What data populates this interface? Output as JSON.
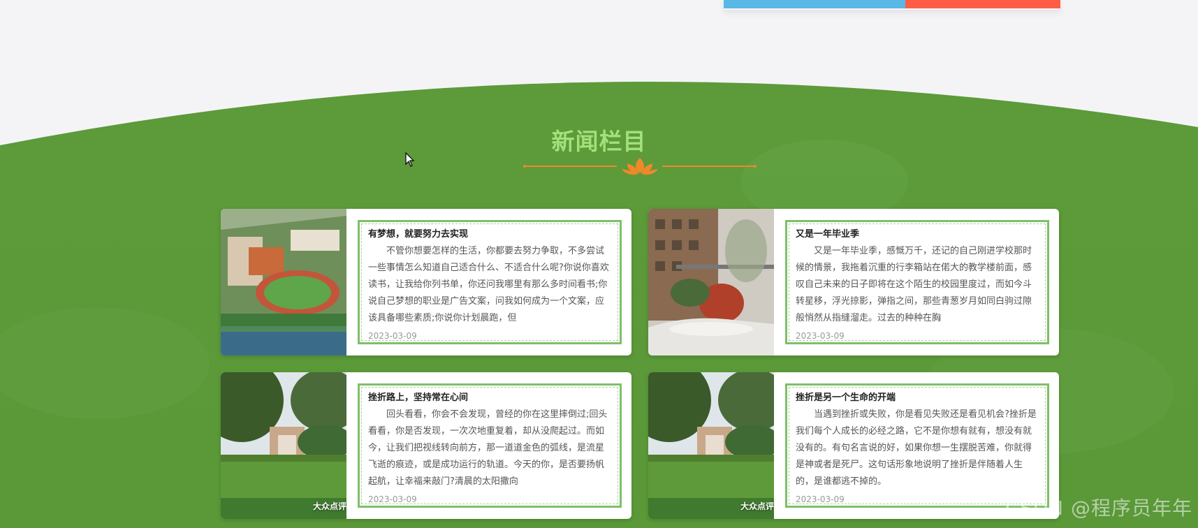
{
  "section": {
    "title": "新闻栏目"
  },
  "news": [
    {
      "title": "有梦想，就要努力去实现",
      "excerpt": "不管你想要怎样的生活，你都要去努力争取，不多尝试一些事情怎么知道自己适合什么、不适合什么呢?你说你喜欢读书，让我给你列书单，你还问我哪里有那么多时间看书;你说自己梦想的职业是广告文案，问我如何成为一个文案，应该具备哪些素质;你说你计划晨跑，但",
      "date": "2023-03-09",
      "image": "campus-aerial"
    },
    {
      "title": "又是一年毕业季",
      "excerpt": "又是一年毕业季，感慨万千，还记的自己刚进学校那时候的情景，我拖着沉重的行李箱站在偌大的教学楼前面，感叹自己未来的日子即将在这个陌生的校园里度过，而如今斗转星移，浮光掠影，弹指之间，那些青葱岁月如同白驹过隙般悄然从指缝溜走。过去的种种在胸",
      "date": "2023-03-09",
      "image": "courtyard"
    },
    {
      "title": "挫折路上，坚持常在心间",
      "excerpt": "回头看看，你会不会发现，曾经的你在这里摔倒过;回头看看，你是否发现，一次次地重复着，却从没爬起过。而如今，让我们把视线转向前方，那一道道金色的弧线，是流星飞逝的痕迹，或是成功运行的轨道。今天的你，是否要扬帆起航，让幸福来敲门?清晨的太阳撒向",
      "date": "2023-03-09",
      "image": "lawn",
      "image_caption": "大众点评"
    },
    {
      "title": "挫折是另一个生命的开端",
      "excerpt": "当遇到挫折或失败，你是看见失败还是看见机会?挫折是我们每个人成长的必经之路，它不是你想有就有，想没有就没有的。有句名言说的好，如果你想一生摆脱苦难，你就得是神或者是死尸。这句话形象地说明了挫折是伴随着人生的，是谁都逃不掉的。",
      "date": "2023-03-09",
      "image": "lawn",
      "image_caption": "大众点评"
    }
  ],
  "watermark": "CSDN @程序员年年",
  "colors": {
    "green_bg": "#5a9a3a",
    "title_green": "#a4e07a",
    "divider_orange": "#f0882a",
    "top_blue": "#5ab8e6",
    "top_red": "#ff5c45"
  }
}
